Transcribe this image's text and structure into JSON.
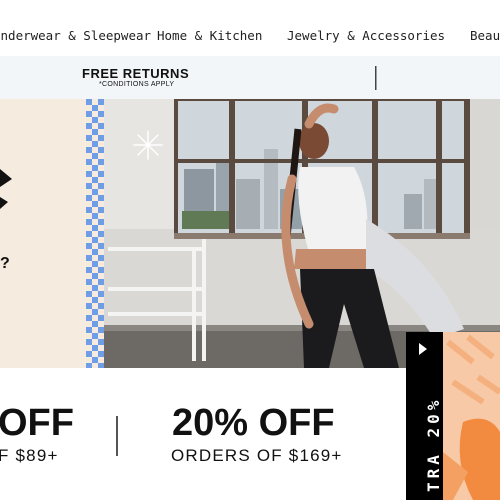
{
  "nav": {
    "categories": [
      "Underwear & Sleepwear",
      "Home & Kitchen",
      "Jewelry & Accessories",
      "Beauty"
    ]
  },
  "promo": {
    "title": "FREE RETURNS",
    "subtitle": "*CONDITIONS APPLY"
  },
  "hero": {
    "left_panel_text": "?"
  },
  "offers": [
    {
      "headline": "OFF",
      "detail": "F $89+"
    },
    {
      "headline": "20% OFF",
      "detail": "ORDERS OF $169+"
    }
  ],
  "side_tab": {
    "label": "TRA 20%"
  },
  "colors": {
    "promo_bg": "#f3f6f9",
    "left_panel_bg": "#f6ebdf",
    "checker_blue": "#6f9ee6",
    "side_tab_bg": "#000000",
    "art_orange": "#f28a3f"
  }
}
